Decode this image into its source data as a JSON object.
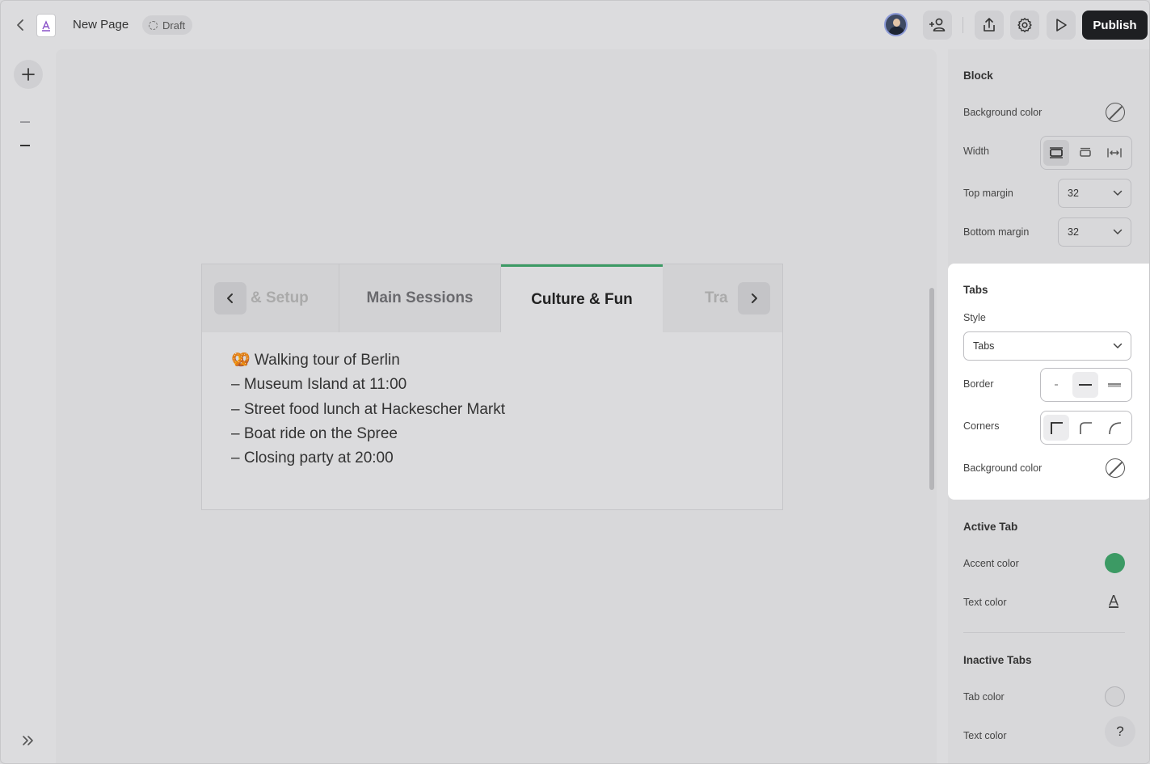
{
  "topbar": {
    "page_title": "New Page",
    "status": "Draft",
    "publish_label": "Publish"
  },
  "tabs_block": {
    "tabs": [
      {
        "label": "& Setup",
        "state": "clipped"
      },
      {
        "label": "Main Sessions",
        "state": "inactive"
      },
      {
        "label": "Culture & Fun",
        "state": "active"
      },
      {
        "label": "Tra",
        "state": "clipped"
      }
    ],
    "content_lines": [
      "🥨 Walking tour of Berlin",
      "– Museum Island at 11:00",
      "– Street food lunch at Hackescher Markt",
      "– Boat ride on the Spree",
      "– Closing party at 20:00"
    ]
  },
  "panel": {
    "block": {
      "title": "Block",
      "background_color_label": "Background color",
      "width_label": "Width",
      "top_margin_label": "Top margin",
      "top_margin_value": "32",
      "bottom_margin_label": "Bottom margin",
      "bottom_margin_value": "32"
    },
    "tabs": {
      "title": "Tabs",
      "style_label": "Style",
      "style_value": "Tabs",
      "border_label": "Border",
      "corners_label": "Corners",
      "background_color_label": "Background color"
    },
    "active_tab": {
      "title": "Active Tab",
      "accent_color_label": "Accent color",
      "text_color_label": "Text color"
    },
    "inactive_tabs": {
      "title": "Inactive Tabs",
      "tab_color_label": "Tab color",
      "text_color_label": "Text color"
    }
  },
  "colors": {
    "accent": "#3c9a64",
    "publish_bg": "#1e1f22",
    "panel_highlight": "#ffffff"
  },
  "help_label": "?"
}
